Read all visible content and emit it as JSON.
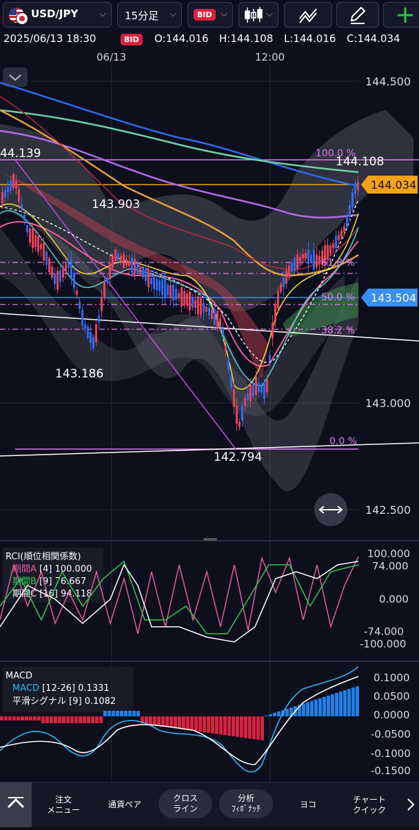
{
  "toolbar": {
    "symbol": "USD/JPY",
    "timeframe": "15分足",
    "price_type": "BID"
  },
  "info": {
    "datetime": "2025/06/13 18:30",
    "badge": "BID",
    "open": "O:144.016",
    "high": "H:144.108",
    "low": "L:144.016",
    "close": "C:144.034"
  },
  "time_axis": [
    "06/13",
    "12:00"
  ],
  "price_axis": [
    "144.500",
    "143.000",
    "142.500"
  ],
  "price_tags": {
    "current": "144.034",
    "line": "143.504"
  },
  "annotations": {
    "hi_left": "44.139",
    "mid_high": "143.903",
    "low_left": "143.186",
    "low_center": "142.794",
    "hi_right": "144.108"
  },
  "fib": [
    {
      "label": "100.0 %",
      "price": 144.139
    },
    {
      "label": "61.8 %",
      "price": 143.753
    },
    {
      "label": "50.0 %",
      "price": 143.517
    },
    {
      "label": "38.2 %",
      "price": 143.38
    },
    {
      "label": "0.0 %",
      "price": 142.794
    }
  ],
  "rci": {
    "title": "RCI(順位相関係数)",
    "rows": [
      {
        "name": "期間A",
        "param": "[4]",
        "value": "100.000",
        "color": "#e75a9c"
      },
      {
        "name": "期間B",
        "param": "[9]",
        "value": "76.667",
        "color": "#2ecb4d"
      },
      {
        "name": "期間C",
        "param": "[16]",
        "value": "94.118",
        "color": "#ffffff"
      }
    ],
    "axis": [
      "100.000",
      "74.000",
      "0.000",
      "-74.000",
      "-100.000"
    ]
  },
  "macd": {
    "title": "MACD",
    "rows": [
      {
        "name": "MACD",
        "param": "[12-26]",
        "value": "0.1331",
        "color": "#32b6f2"
      },
      {
        "name": "平滑シグナル",
        "param": "[9]",
        "value": "0.1082",
        "color": "#ffffff"
      }
    ],
    "axis": [
      "0.1000",
      "0.0500",
      "0.0000",
      "-0.0500",
      "-0.1000",
      "-0.1500"
    ]
  },
  "nav": {
    "items": [
      "注文\nメニュー",
      "通貨ペア",
      "クロス\nライン",
      "分析\nﾌｨﾎﾞﾅｯﾁ",
      "ヨコ",
      "チャート\nクイック"
    ]
  },
  "colors": {
    "bg": "#0d0f1d",
    "up": "#2f6bf0",
    "down": "#e8435b",
    "bid": "#d8223f",
    "orange_tag": "#f3a21a",
    "blue_tag": "#3a8ef0",
    "fib": "#e07af0",
    "add_button": "#25c93f"
  }
}
